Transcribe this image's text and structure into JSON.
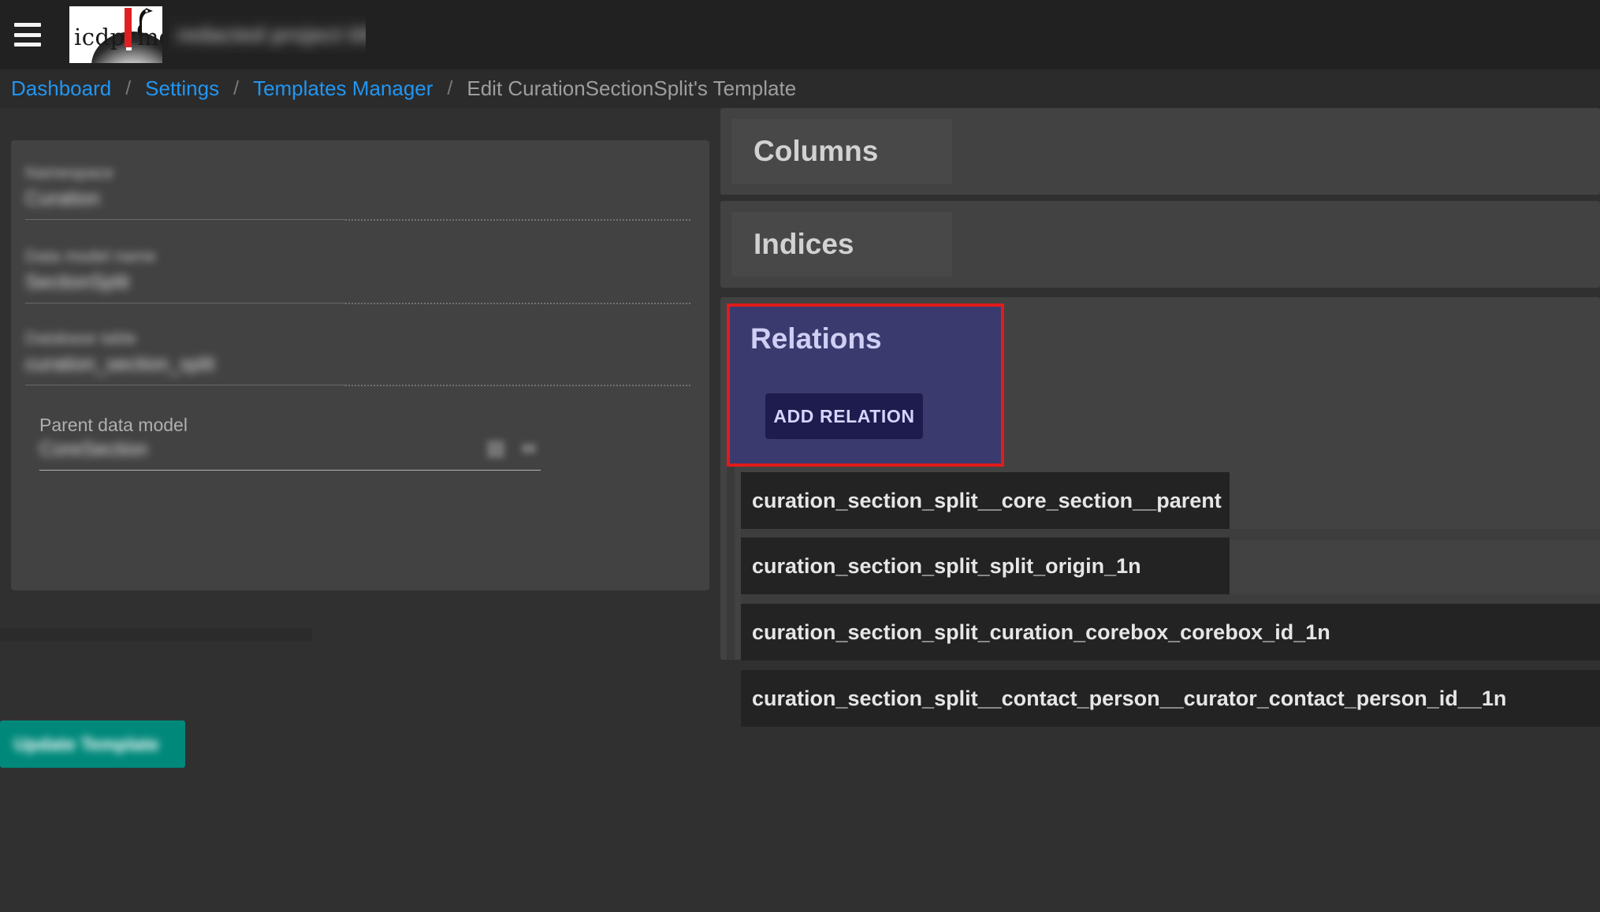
{
  "header": {
    "menu_icon": "hamburger-menu-icon",
    "logo_text_left": "icdp",
    "logo_text_right": "md",
    "logo_icon": "woodpecker-bird-icon",
    "title_redacted": "redacted project title"
  },
  "breadcrumb": {
    "items": [
      {
        "label": "Dashboard",
        "current": false
      },
      {
        "label": "Settings",
        "current": false
      },
      {
        "label": "Templates Manager",
        "current": false
      },
      {
        "label": "Edit CurationSectionSplit's Template",
        "current": true
      }
    ],
    "separator": "/"
  },
  "left_panel": {
    "fields": [
      {
        "label_redacted": "Namespace",
        "value_redacted": "Curation"
      },
      {
        "label_redacted": "Data model name",
        "value_redacted": "SectionSplit"
      },
      {
        "label_redacted": "Database table",
        "value_redacted": "curation_section_split"
      },
      {
        "label": "Parent data model",
        "value_redacted": "CoreSection"
      }
    ],
    "submit_button_label_redacted": "Update Template"
  },
  "right_panel": {
    "panels": [
      {
        "title": "Columns"
      },
      {
        "title": "Indices"
      }
    ],
    "relations": {
      "title": "Relations",
      "add_button_label": "ADD RELATION",
      "highlight_color": "#e01b1b",
      "card_color": "#3b3a6e",
      "items": [
        {
          "name": "curation_section_split__core_section__parent",
          "width": "narrow"
        },
        {
          "name": "curation_section_split_split_origin_1n",
          "width": "narrow"
        },
        {
          "name": "curation_section_split_curation_corebox_corebox_id_1n",
          "width": "wide"
        },
        {
          "name": "curation_section_split__contact_person__curator_contact_person_id__1n",
          "width": "wide"
        }
      ]
    }
  },
  "colors": {
    "header_bg": "#212121",
    "breadcrumb_bg": "#2b2b2b",
    "page_bg": "#303030",
    "card_bg": "#424242",
    "link": "#2196f3",
    "teal_accent": "#00897b"
  }
}
